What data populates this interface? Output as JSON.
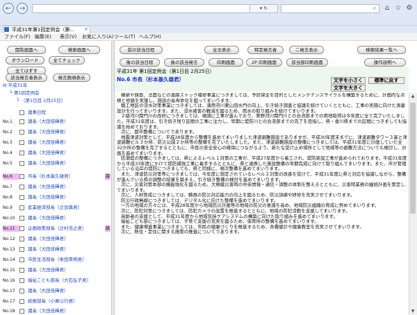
{
  "browser": {
    "tab_title": "平成31年第1回定例会（第...",
    "tab_close": "×",
    "addr_buttons": "▾ ↻",
    "search_icon": "search-icon",
    "menu": [
      "ファイル(F)",
      "編集(E)",
      "表示(V)",
      "お気に入り(A)",
      "ツール(T)",
      "ヘルプ(H)"
    ]
  },
  "left": {
    "buttons": {
      "toc": "閲覧画面へ",
      "search": "検索画面へ",
      "download": "ダウンロード",
      "check_all": "全てチェック",
      "uncheck_all": "全てはずす",
      "speaker_list": "該当発言者表示",
      "speech_count": "発言数順表示"
    },
    "tree": {
      "year": "平成31年",
      "session": "第1回定例会",
      "date": "（第1日目 2月25日）",
      "agenda": "議事日程"
    },
    "rows": [
      {
        "no": "No.1",
        "name": "議長（大田佳輝君）"
      },
      {
        "no": "No.2",
        "name": "議長（大田佳輝君）"
      },
      {
        "no": "No.3",
        "name": "議長（大田佳輝君）"
      },
      {
        "no": "No.4",
        "name": "議長（大田佳輝君）"
      },
      {
        "no": "No.5",
        "name": "議長（大田佳輝君）"
      },
      {
        "no": "No.6",
        "name": "市長（杉本基久雄君）",
        "hl": true
      },
      {
        "no": "No.7",
        "name": "議長（大田佳輝君）"
      },
      {
        "no": "No.8",
        "name": "議長（大田佳輝君）"
      },
      {
        "no": "No.9",
        "name": "産業経済部長（辻良典君）"
      },
      {
        "no": "No.10",
        "name": "議長（大田佳輝君）"
      },
      {
        "no": "No.11",
        "name": "企画政策部長（辻村浩之君）",
        "hl": true
      },
      {
        "no": "No.12",
        "name": "議長（大田佳輝君）"
      },
      {
        "no": "No.13",
        "name": "議長（大田佳輝君）"
      },
      {
        "no": "No.14",
        "name": "市民生活部長（条田貴明君）"
      },
      {
        "no": "No.15",
        "name": "議長（大田佳輝君）"
      },
      {
        "no": "No.16",
        "name": "福祉こども部長（大石弘子君）"
      },
      {
        "no": "No.17",
        "name": "議長（大田佳輝君）"
      },
      {
        "no": "No.17",
        "name": "総務部長（小栗以行君）"
      },
      {
        "no": "No.18",
        "name": "議長（大田佳輝君）"
      }
    ],
    "tag": "該"
  },
  "right": {
    "buttons": {
      "prev_agenda": "前の該当日程",
      "full_text": "全文表示",
      "specific_speaker": "特定発言者",
      "two_col": "二発言表示",
      "to_results": "検索結果一覧へ",
      "next_agenda": "後の該当日程",
      "next_speech": "後の該当発言",
      "print": "印刷画面",
      "print_2p": "2P 印刷画面",
      "print_selected": "該当部印刷画面",
      "print_all": "操作説明へ"
    },
    "doc_title": "平成31年 第1回定例会（第1日目 2月25日）",
    "speaker": "No.6 市長（杉本基久雄君）",
    "font_smaller": "文字を小さく",
    "font_standard": "標準に戻す",
    "font_larger": "文字を大きく",
    "paragraphs": [
      "横梁や鋳筋、法面などの道路ストック補修事業につきましては、予防保全を目的としたメンテナンスサイクルを構築するために、計画的な点検と修繕を実施し、施設の長寿命化を図ってまいります。",
      "鍛工地区の浸水対策事業につきましては、湧用河川東山田水門の向上、引き続き調査と協議を続けていくとともに、工事の実施に向けた測量設計を行ってまいります。また、浸水被害の軽減を図るため、雨水の取り組みを続けてまいります。",
      "２級河川関門川の改修につきましては、順調に工事が進んでおり、第野河川関門川との合流部までの用地取得は今年度に全て完了いたしました。平成31年度は、引き続き残り区間の工事に注力し、早期に堤防川との合流部までの完了を目指し、県・香川県までの区間につきましても協議を始めております。",
      "次に、都市整備についてであります。",
      "地震津波対策として、平成28年度から整備を進めてまいりました津波避難施設でありますが、平成30年度末までに、津波避難タワー３基と津波避難ビル３か所、防災公園２か所等の整備を完了いたしました。また、津波避難施設の整備につきましては、平成31年度に計画していた全32か所の整備を完了するとともに、市民の安全安心の確保につながるよう、新たな受け止め場所として地域等の避難方法についても検討し、計画を進めてまいります。",
      "防潮堤の整備につきましては、県によるレベル１対策の工事が、平成27年度から着工され、堤防新設工事が進められております。平成31年度から平成33年度にかけて堤防補強工事に着手するとともに、県と連携した施設整備の早期完成に向けて取り組んでまいります。また、市が管理している沿岸の堤防につきましても、県と同様に、順次整備を進めてまいります。",
      "また、津波防災対策等につきましては、今年度に想定されているレベル２対策の改善を受けて、平成31年度に県と対応を協議しながら、整備が進んでいる県の調整の結果を踏まえ、引き続き整備の検討を進めてまいります。",
      "次に、災害対策本部の機能強化を図るため、大規模災害時の中央情報・通信・調整の体制を整えるとともに、災害時業務の継続計画を策定してまいります。",
      "次に、人材育成につきましては、職員の防災対応能力の向上を図るため、防災訓練や研修を充実させてまいります。",
      "防災行政無線につきましては、デジタル化に向けた整備を進めてまいります。",
      "一方の地域の方々には、平成28年度から地域防災計画等の地域の防災の意識を高め、地域防災組織の育成に努めてまいります。",
      "次に、防犯対策につきましては、防犯カメラの設置を推進するとともに、地域の防犯活動を支援してまいります。",
      "高齢者の支援として、平成31年度から地域包括ケアシステムの構築に向けた取り組みを進めてまいります。",
      "福祉こども部につきましては、子育て支援の充実を図るため、保育所の整備を進めてまいります。",
      "また、健康増進事業につきましては、市民の健康づくりを推進するため、各種健診や健康教室を充実させてまいります。",
      "次に、移住・定住に関する施策の推進についてであります。"
    ]
  }
}
